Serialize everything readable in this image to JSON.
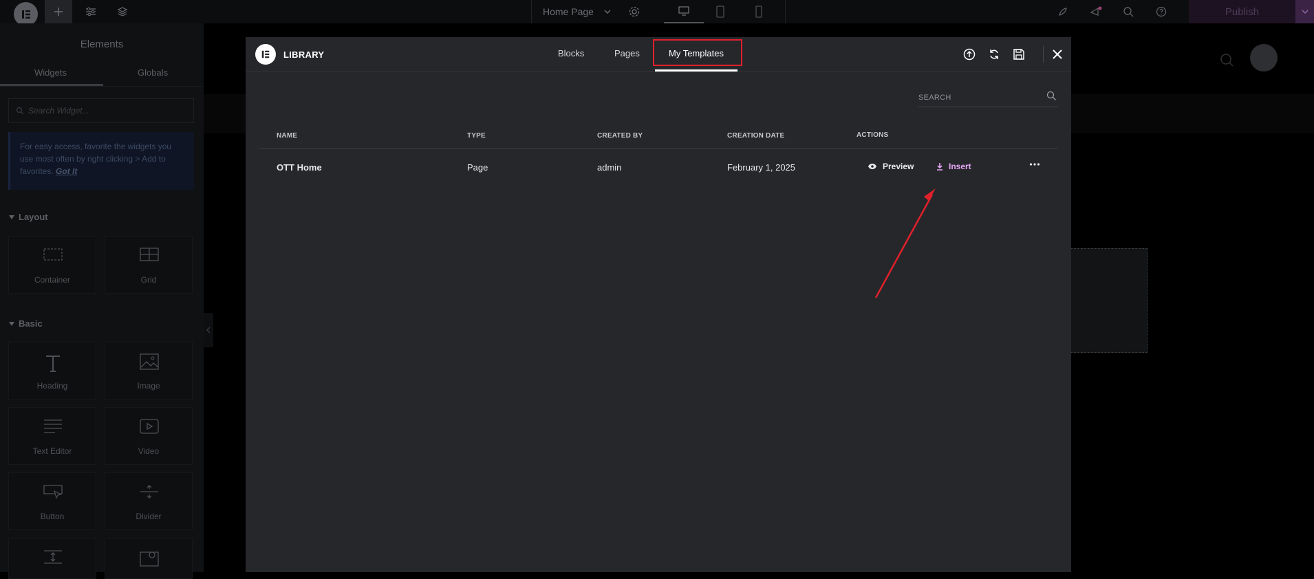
{
  "topbar": {
    "page_name": "Home Page",
    "publish_label": "Publish"
  },
  "sidebar": {
    "title": "Elements",
    "tabs": [
      "Widgets",
      "Globals"
    ],
    "search_placeholder": "Search Widget...",
    "tip": {
      "text": "For easy access, favorite the widgets you use most often by right clicking > Add to favorites.",
      "link": "Got It"
    },
    "categories": {
      "layout": "Layout",
      "basic": "Basic"
    },
    "widgets": {
      "container": "Container",
      "grid": "Grid",
      "heading": "Heading",
      "image": "Image",
      "text_editor": "Text Editor",
      "video": "Video",
      "button": "Button",
      "divider": "Divider"
    }
  },
  "library": {
    "title": "LIBRARY",
    "tabs": [
      "Blocks",
      "Pages",
      "My Templates"
    ],
    "active_tab": "My Templates",
    "search_placeholder": "SEARCH",
    "columns": [
      "NAME",
      "TYPE",
      "CREATED BY",
      "CREATION DATE",
      "ACTIONS"
    ],
    "rows": [
      {
        "name": "OTT Home",
        "type": "Page",
        "created_by": "admin",
        "creation_date": "February 1, 2025",
        "preview_label": "Preview",
        "insert_label": "Insert"
      }
    ]
  },
  "colors": {
    "modal_bg": "#26272b",
    "insert_accent": "#e6a6f6",
    "annotation_red": "#e0212b"
  }
}
